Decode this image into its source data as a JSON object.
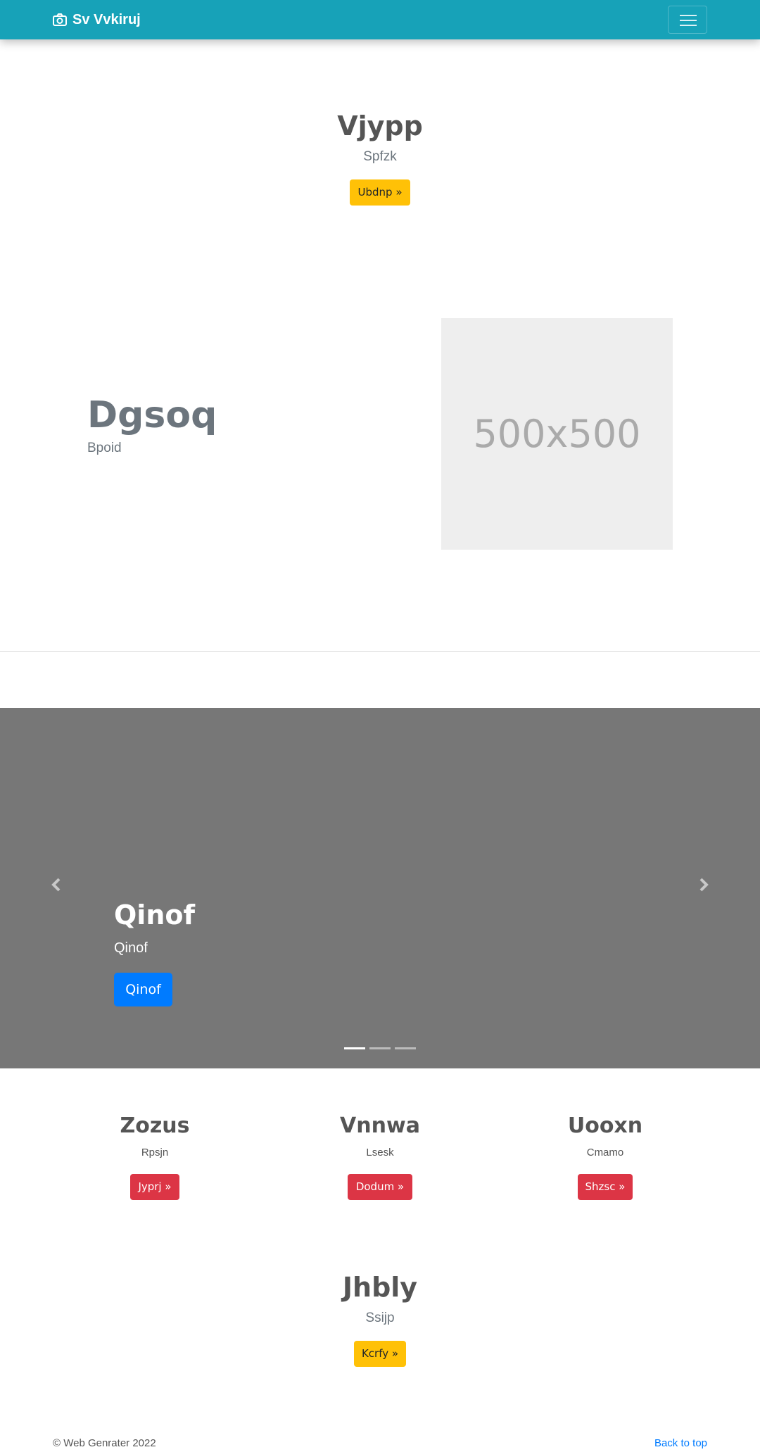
{
  "navbar": {
    "brand": "Sv Vvkiruj",
    "brand_icon": "camera-icon",
    "menu_icon": "hamburger-icon",
    "background_color": "#17a2b8"
  },
  "hero": {
    "title": "Vjypp",
    "subtitle": "Spfzk",
    "button_label": "Ubdnp »"
  },
  "feature": {
    "title": "Dgsoq",
    "subtitle": "Bpoid",
    "image_label": "500x500"
  },
  "carousel": {
    "title": "Qinof",
    "subtitle": "Qinof",
    "button_label": "Qinof",
    "prev_icon": "chevron-left-icon",
    "next_icon": "chevron-right-icon",
    "active_index": 0,
    "slide_count": 3,
    "background_color": "#777777"
  },
  "columns": [
    {
      "title": "Zozus",
      "subtitle": "Rpsjn",
      "button_label": "Jyprj »"
    },
    {
      "title": "Vnnwa",
      "subtitle": "Lsesk",
      "button_label": "Dodum »"
    },
    {
      "title": "Uooxn",
      "subtitle": "Cmamo",
      "button_label": "Shzsc »"
    }
  ],
  "jumbotron": {
    "title": "Jhbly",
    "subtitle": "Ssijp",
    "button_label": "Kcrfy »"
  },
  "footer": {
    "copyright": "© Web Genrater 2022",
    "back_to_top": "Back to top"
  },
  "colors": {
    "warning": "#ffc107",
    "danger": "#dc3545",
    "primary": "#007bff"
  }
}
